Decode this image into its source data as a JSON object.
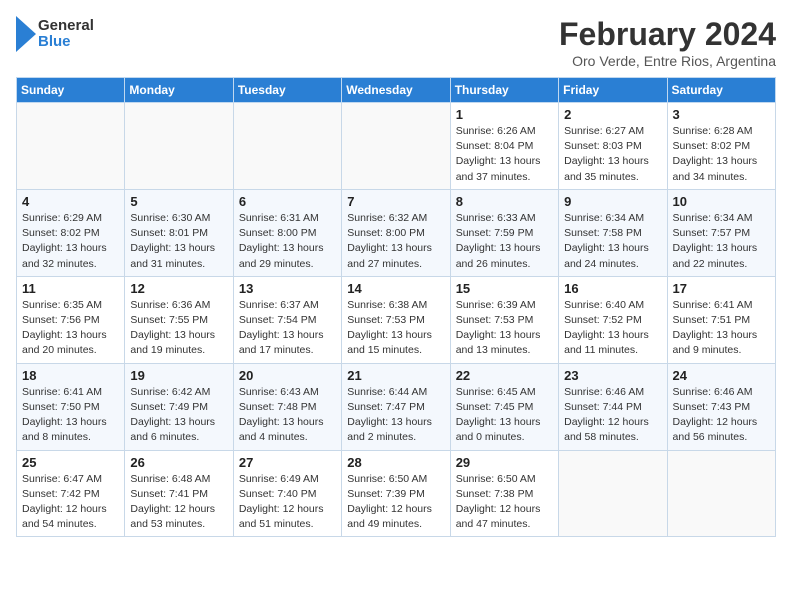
{
  "header": {
    "logo_line1": "General",
    "logo_line2": "Blue",
    "month_title": "February 2024",
    "subtitle": "Oro Verde, Entre Rios, Argentina"
  },
  "days_of_week": [
    "Sunday",
    "Monday",
    "Tuesday",
    "Wednesday",
    "Thursday",
    "Friday",
    "Saturday"
  ],
  "weeks": [
    [
      {
        "num": "",
        "info": ""
      },
      {
        "num": "",
        "info": ""
      },
      {
        "num": "",
        "info": ""
      },
      {
        "num": "",
        "info": ""
      },
      {
        "num": "1",
        "info": "Sunrise: 6:26 AM\nSunset: 8:04 PM\nDaylight: 13 hours\nand 37 minutes."
      },
      {
        "num": "2",
        "info": "Sunrise: 6:27 AM\nSunset: 8:03 PM\nDaylight: 13 hours\nand 35 minutes."
      },
      {
        "num": "3",
        "info": "Sunrise: 6:28 AM\nSunset: 8:02 PM\nDaylight: 13 hours\nand 34 minutes."
      }
    ],
    [
      {
        "num": "4",
        "info": "Sunrise: 6:29 AM\nSunset: 8:02 PM\nDaylight: 13 hours\nand 32 minutes."
      },
      {
        "num": "5",
        "info": "Sunrise: 6:30 AM\nSunset: 8:01 PM\nDaylight: 13 hours\nand 31 minutes."
      },
      {
        "num": "6",
        "info": "Sunrise: 6:31 AM\nSunset: 8:00 PM\nDaylight: 13 hours\nand 29 minutes."
      },
      {
        "num": "7",
        "info": "Sunrise: 6:32 AM\nSunset: 8:00 PM\nDaylight: 13 hours\nand 27 minutes."
      },
      {
        "num": "8",
        "info": "Sunrise: 6:33 AM\nSunset: 7:59 PM\nDaylight: 13 hours\nand 26 minutes."
      },
      {
        "num": "9",
        "info": "Sunrise: 6:34 AM\nSunset: 7:58 PM\nDaylight: 13 hours\nand 24 minutes."
      },
      {
        "num": "10",
        "info": "Sunrise: 6:34 AM\nSunset: 7:57 PM\nDaylight: 13 hours\nand 22 minutes."
      }
    ],
    [
      {
        "num": "11",
        "info": "Sunrise: 6:35 AM\nSunset: 7:56 PM\nDaylight: 13 hours\nand 20 minutes."
      },
      {
        "num": "12",
        "info": "Sunrise: 6:36 AM\nSunset: 7:55 PM\nDaylight: 13 hours\nand 19 minutes."
      },
      {
        "num": "13",
        "info": "Sunrise: 6:37 AM\nSunset: 7:54 PM\nDaylight: 13 hours\nand 17 minutes."
      },
      {
        "num": "14",
        "info": "Sunrise: 6:38 AM\nSunset: 7:53 PM\nDaylight: 13 hours\nand 15 minutes."
      },
      {
        "num": "15",
        "info": "Sunrise: 6:39 AM\nSunset: 7:53 PM\nDaylight: 13 hours\nand 13 minutes."
      },
      {
        "num": "16",
        "info": "Sunrise: 6:40 AM\nSunset: 7:52 PM\nDaylight: 13 hours\nand 11 minutes."
      },
      {
        "num": "17",
        "info": "Sunrise: 6:41 AM\nSunset: 7:51 PM\nDaylight: 13 hours\nand 9 minutes."
      }
    ],
    [
      {
        "num": "18",
        "info": "Sunrise: 6:41 AM\nSunset: 7:50 PM\nDaylight: 13 hours\nand 8 minutes."
      },
      {
        "num": "19",
        "info": "Sunrise: 6:42 AM\nSunset: 7:49 PM\nDaylight: 13 hours\nand 6 minutes."
      },
      {
        "num": "20",
        "info": "Sunrise: 6:43 AM\nSunset: 7:48 PM\nDaylight: 13 hours\nand 4 minutes."
      },
      {
        "num": "21",
        "info": "Sunrise: 6:44 AM\nSunset: 7:47 PM\nDaylight: 13 hours\nand 2 minutes."
      },
      {
        "num": "22",
        "info": "Sunrise: 6:45 AM\nSunset: 7:45 PM\nDaylight: 13 hours\nand 0 minutes."
      },
      {
        "num": "23",
        "info": "Sunrise: 6:46 AM\nSunset: 7:44 PM\nDaylight: 12 hours\nand 58 minutes."
      },
      {
        "num": "24",
        "info": "Sunrise: 6:46 AM\nSunset: 7:43 PM\nDaylight: 12 hours\nand 56 minutes."
      }
    ],
    [
      {
        "num": "25",
        "info": "Sunrise: 6:47 AM\nSunset: 7:42 PM\nDaylight: 12 hours\nand 54 minutes."
      },
      {
        "num": "26",
        "info": "Sunrise: 6:48 AM\nSunset: 7:41 PM\nDaylight: 12 hours\nand 53 minutes."
      },
      {
        "num": "27",
        "info": "Sunrise: 6:49 AM\nSunset: 7:40 PM\nDaylight: 12 hours\nand 51 minutes."
      },
      {
        "num": "28",
        "info": "Sunrise: 6:50 AM\nSunset: 7:39 PM\nDaylight: 12 hours\nand 49 minutes."
      },
      {
        "num": "29",
        "info": "Sunrise: 6:50 AM\nSunset: 7:38 PM\nDaylight: 12 hours\nand 47 minutes."
      },
      {
        "num": "",
        "info": ""
      },
      {
        "num": "",
        "info": ""
      }
    ]
  ]
}
